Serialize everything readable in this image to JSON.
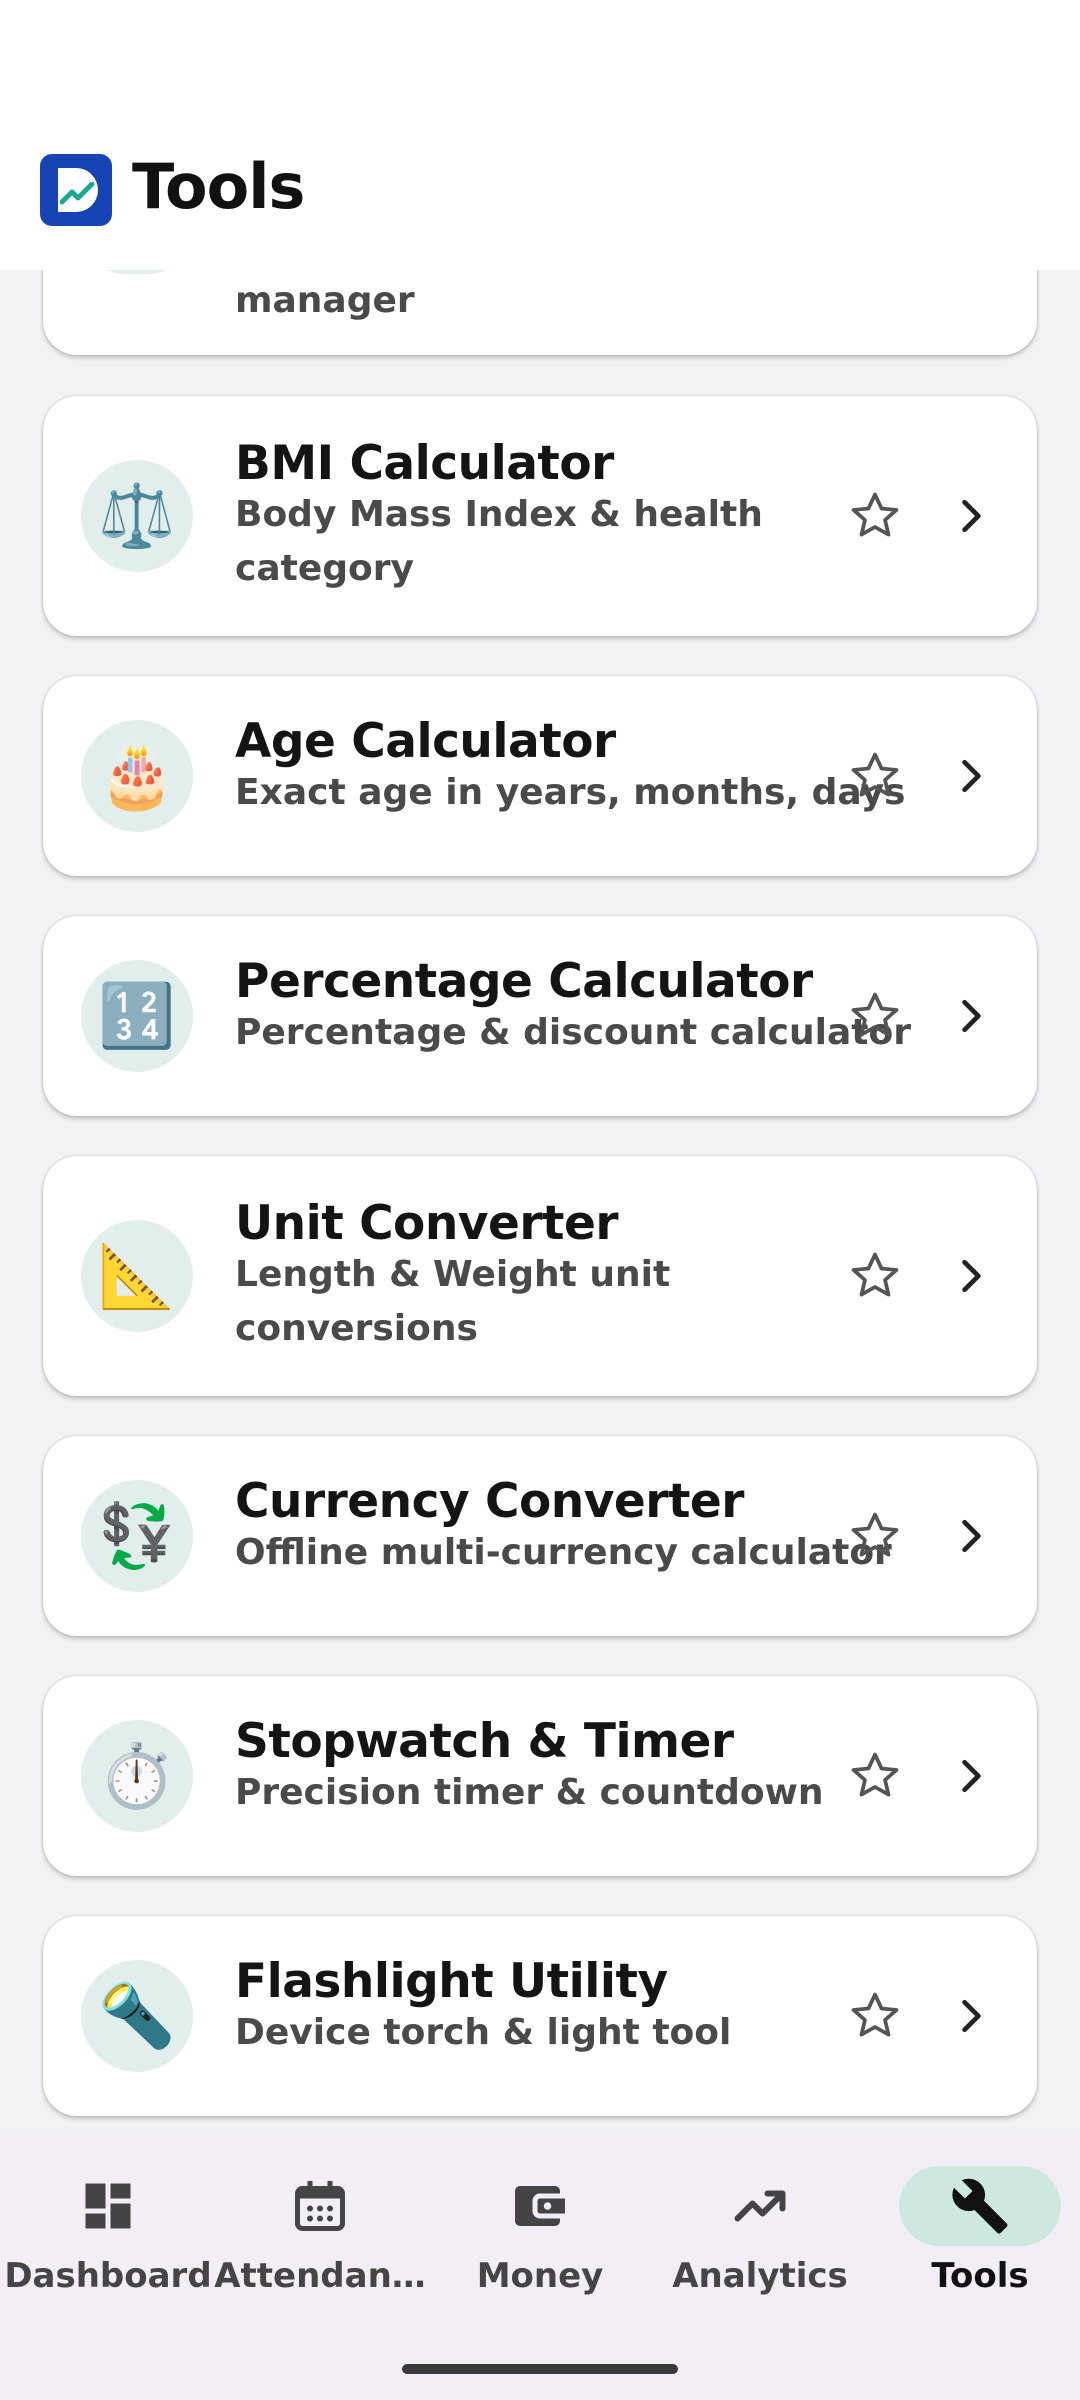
{
  "header": {
    "title": "Tools"
  },
  "partial_card": {
    "subtitle_tail": "manager"
  },
  "tools": [
    {
      "title": "BMI Calculator",
      "subtitle": "Body Mass Index & health category",
      "icon": "⚖️",
      "icon_name": "scale-icon"
    },
    {
      "title": "Age Calculator",
      "subtitle": "Exact age in years, months, days",
      "icon": "🎂",
      "icon_name": "cake-icon"
    },
    {
      "title": "Percentage Calculator",
      "subtitle": "Percentage & discount calculator",
      "icon": "🔢",
      "icon_name": "numbers-icon"
    },
    {
      "title": "Unit Converter",
      "subtitle": "Length & Weight unit conversions",
      "icon": "📐",
      "icon_name": "ruler-icon"
    },
    {
      "title": "Currency Converter",
      "subtitle": "Offline multi-currency calculator",
      "icon": "💱",
      "icon_name": "currency-exchange-icon"
    },
    {
      "title": "Stopwatch & Timer",
      "subtitle": "Precision timer & countdown",
      "icon": "⏱️",
      "icon_name": "stopwatch-icon"
    },
    {
      "title": "Flashlight Utility",
      "subtitle": "Device torch & light tool",
      "icon": "🔦",
      "icon_name": "flashlight-icon"
    }
  ],
  "nav": {
    "items": [
      {
        "label": "Dashboard",
        "icon": "dashboard-icon"
      },
      {
        "label": "Attendan…",
        "icon": "calendar-icon"
      },
      {
        "label": "Money",
        "icon": "wallet-icon"
      },
      {
        "label": "Analytics",
        "icon": "trending-up-icon"
      },
      {
        "label": "Tools",
        "icon": "wrench-icon",
        "active": true
      }
    ]
  },
  "colors": {
    "accent_pill": "#cde9df",
    "icon_circle": "#e2eeeb",
    "logo": "#1744b4",
    "background": "#f2f2f4"
  }
}
